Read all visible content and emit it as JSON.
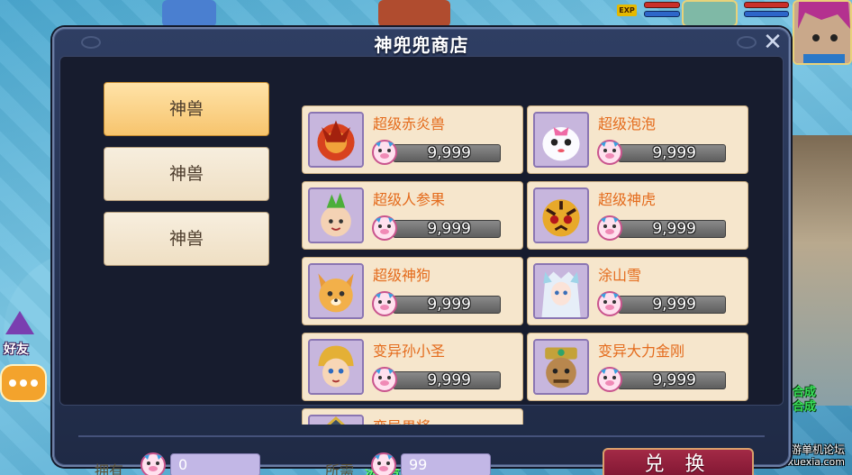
{
  "shop": {
    "title": "神兜兜商店",
    "close": "✕"
  },
  "tabs": [
    {
      "label": "神兽",
      "active": true
    },
    {
      "label": "神兽",
      "active": false
    },
    {
      "label": "神兽",
      "active": false
    }
  ],
  "items": [
    {
      "name": "超级赤炎兽",
      "price": "9,999",
      "icon": "fire-beast-icon"
    },
    {
      "name": "超级泡泡",
      "price": "9,999",
      "icon": "bubble-pet-icon"
    },
    {
      "name": "超级人参果",
      "price": "9,999",
      "icon": "ginseng-pet-icon"
    },
    {
      "name": "超级神虎",
      "price": "9,999",
      "icon": "tiger-pet-icon"
    },
    {
      "name": "超级神狗",
      "price": "9,999",
      "icon": "dog-pet-icon"
    },
    {
      "name": "涂山雪",
      "price": "9,999",
      "icon": "fox-girl-icon"
    },
    {
      "name": "变异孙小圣",
      "price": "9,999",
      "icon": "monkey-king-icon"
    },
    {
      "name": "变异大力金刚",
      "price": "9,999",
      "icon": "king-kong-icon"
    },
    {
      "name": "变异男将",
      "price": "",
      "icon": "general-icon"
    }
  ],
  "bottom": {
    "own_label": "拥有",
    "own_value": "0",
    "need_label": "所需",
    "need_value": "99",
    "exchange_button": "兑 换"
  },
  "hud": {
    "exp_tag": "EXP",
    "friend_label": "好友",
    "combine_1": "合成",
    "combine_2": "合成",
    "watermark_1": "热血侠网游单机论坛",
    "watermark_2": "www.rexuexia.com",
    "bottom_hint": "法宝合成使者"
  },
  "colors": {
    "item_name": "#e46b1c",
    "exchange_button": "#8f1f3b",
    "active_tab": "#f7c46d"
  }
}
